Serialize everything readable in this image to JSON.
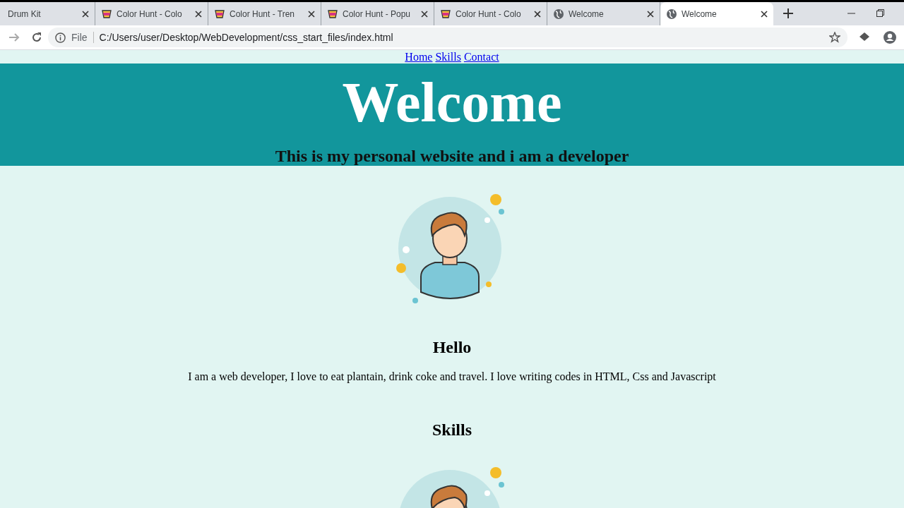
{
  "browser": {
    "tabs": [
      {
        "title": "Drum Kit",
        "selected": false
      },
      {
        "title": "Color Hunt - Colo",
        "kind": "cup",
        "selected": false
      },
      {
        "title": "Color Hunt - Tren",
        "kind": "cup",
        "selected": false
      },
      {
        "title": "Color Hunt - Popu",
        "kind": "cup",
        "selected": false
      },
      {
        "title": "Color Hunt - Colo",
        "kind": "cup",
        "selected": false
      },
      {
        "title": "Welcome",
        "kind": "globe",
        "selected": false
      },
      {
        "title": "Welcome",
        "kind": "globe",
        "selected": true
      }
    ],
    "address_bar": {
      "scheme": "File",
      "url": "C:/Users/user/Desktop/WebDevelopment/css_start_files/index.html"
    }
  },
  "page": {
    "nav": [
      "Home",
      "Skills",
      "Contact"
    ],
    "header": {
      "title": "Welcome",
      "subtitle": "This is my personal website and i am a developer"
    },
    "blocks": [
      {
        "kind": "avatar"
      },
      {
        "kind": "heading",
        "text": "Hello"
      },
      {
        "kind": "paragraph",
        "text": "I am a web developer, I love to eat plantain, drink coke and travel. I love writing codes in HTML, Css and Javascript"
      },
      {
        "kind": "heading",
        "text": "Skills"
      },
      {
        "kind": "avatar"
      }
    ]
  }
}
